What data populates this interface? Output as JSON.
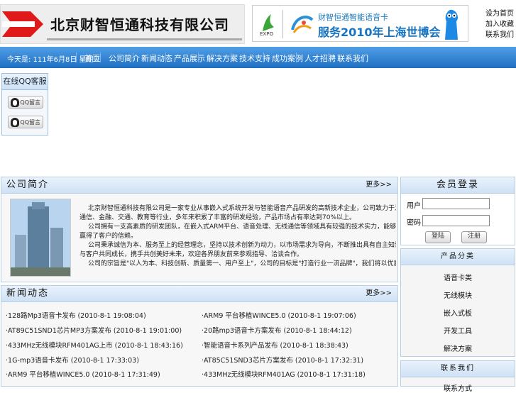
{
  "header": {
    "company_name": "北京财智恒通科技有限公司",
    "banner_line1": "财智恒通智能语音卡",
    "banner_line2": "服务2010年上海世博会",
    "top_links": [
      "设为首页",
      "加入收藏",
      "联系我们"
    ]
  },
  "nav": {
    "date_text": "今天是: 111年6月8日 星期三",
    "items": [
      "首页",
      "公司简介",
      "新闻动态",
      "产品展示",
      "解决方案",
      "技术支持",
      "成功案例",
      "人才招聘",
      "联系我们"
    ]
  },
  "qq": {
    "title": "在线QQ客服",
    "btn_label": "QQ留言"
  },
  "intro": {
    "title": "公司简介",
    "more": "更多>>",
    "paragraphs": [
      "北京财智恒通科技有限公司是一家专业从事嵌入式系统开发与智能语音产品研发的高新技术企业，公司致力于为客户提供优质的产品和完善的服务，产品广泛应用于",
      "通信、金融、交通、教育等行业，多年来积累了丰富的研发经验，产品市场占有率达到70%以上。",
      "公司拥有一支高素质的研发团队，在嵌入式ARM平台、语音处理、无线通信等领域具有较强的技术实力，能够根据客户需求快速定制开发各类解决方案，",
      "赢得了客户的信赖。",
      "公司秉承诚信为本、服务至上的经营理念，坚持以技术创新为动力，以市场需求为导向，不断推出具有自主知识产权的新产品，为客户创造更大的价值，",
      "与客户共同成长，携手共创美好未来，欢迎各界朋友前来参观指导、洽谈合作。",
      "公司的宗旨是\"以人为本、科技创新、质量第一、用户至上\"，公司的目标是\"打造行业一流品牌\"，我们将以优质的产品和服务回报社会各界的支持与厚爱。"
    ]
  },
  "news": {
    "title": "新闻动态",
    "more": "更多>>",
    "items": [
      "·128路Mp3语音卡发布 (2010-8-1 19:08:04)",
      "·ARM9 平台移植WINCE5.0 (2010-8-1 19:07:06)",
      "·AT89C51SND1芯片MP3方案发布 (2010-8-1 19:01:00)",
      "·20路mp3语音卡方案发布 (2010-8-1 18:44:12)",
      "·433MHz无线模块RFM401AG上市 (2010-8-1 18:43:16)",
      "·智能语音卡系列产品发布 (2010-8-1 18:38:43)",
      "·1G-mp3语音卡发布 (2010-8-1 17:33:03)",
      "·AT85C51SND3芯片方案发布 (2010-8-1 17:32:31)",
      "·ARM9 平台移植WINCE5.0 (2010-8-1 17:31:49)",
      "·433MHz无线模块RFM401AG (2010-8-1 17:31:18)"
    ]
  },
  "login": {
    "title": "会员登录",
    "user_label": "用户",
    "pass_label": "密码",
    "login_btn": "登陆",
    "register_btn": "注册"
  },
  "products": {
    "title": "产品分类",
    "items": [
      "语音卡类",
      "无线模块",
      "嵌入式板",
      "开发工具",
      "解决方案"
    ]
  },
  "contact": {
    "title": "联系我们",
    "items": [
      "联系方式"
    ]
  },
  "colors": {
    "nav_top": "#4f9ee6",
    "nav_bottom": "#1f6fc2",
    "panel_border": "#b8cfe6"
  }
}
